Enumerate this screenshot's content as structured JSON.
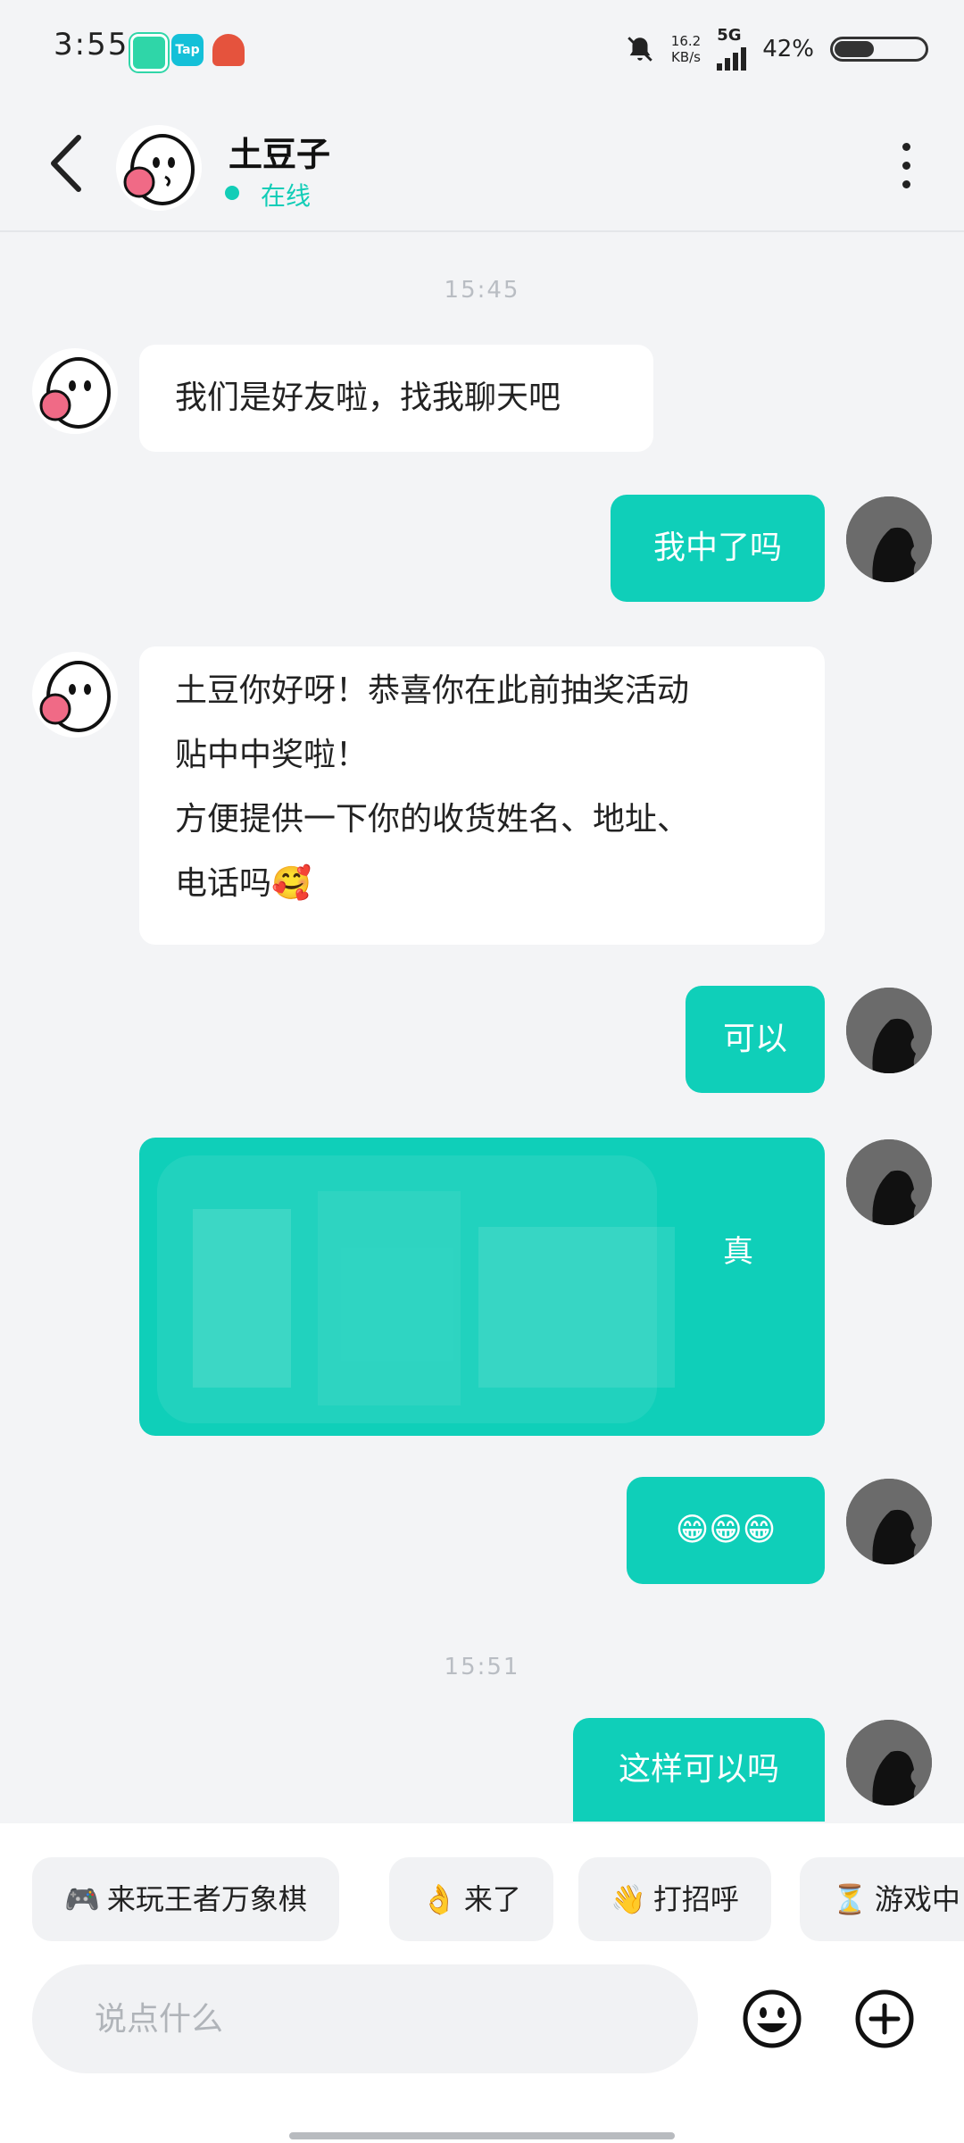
{
  "status_bar": {
    "time": "3:55",
    "speed_value": "16.2",
    "speed_unit": "KB/s",
    "network": "5G",
    "battery": "42%",
    "icons": [
      "camera-app-icon",
      "tap-app-icon",
      "game-app-icon",
      "mute-bell-icon",
      "signal-icon",
      "battery-icon"
    ]
  },
  "header": {
    "name": "土豆子",
    "status": "在线",
    "status_color": "#12cdb7"
  },
  "chat": {
    "timestamps": [
      "15:45",
      "15:51"
    ],
    "messages": [
      {
        "side": "in",
        "text": "我们是好友啦，找我聊天吧"
      },
      {
        "side": "out",
        "text": "我中了吗"
      },
      {
        "side": "in",
        "line1": "土豆你好呀！恭喜你在此前抽奖活动",
        "line2": "贴中中奖啦！",
        "line3": "方便提供一下你的收货姓名、地址、",
        "line4": "电话吗🥰"
      },
      {
        "side": "out",
        "text": "可以"
      },
      {
        "side": "out",
        "text": "真",
        "redacted": true
      },
      {
        "side": "out",
        "text": "😁😁😁"
      },
      {
        "side": "out",
        "text": "这样可以吗"
      }
    ]
  },
  "quick_replies": [
    {
      "emoji": "🎮",
      "label": "来玩王者万象棋"
    },
    {
      "emoji": "👌",
      "label": "来了"
    },
    {
      "emoji": "👋",
      "label": "打招呼"
    },
    {
      "emoji": "⏳",
      "label": "游戏中"
    }
  ],
  "input": {
    "placeholder": "说点什么"
  },
  "colors": {
    "accent": "#0fcfb9",
    "background": "#f3f4f6"
  }
}
